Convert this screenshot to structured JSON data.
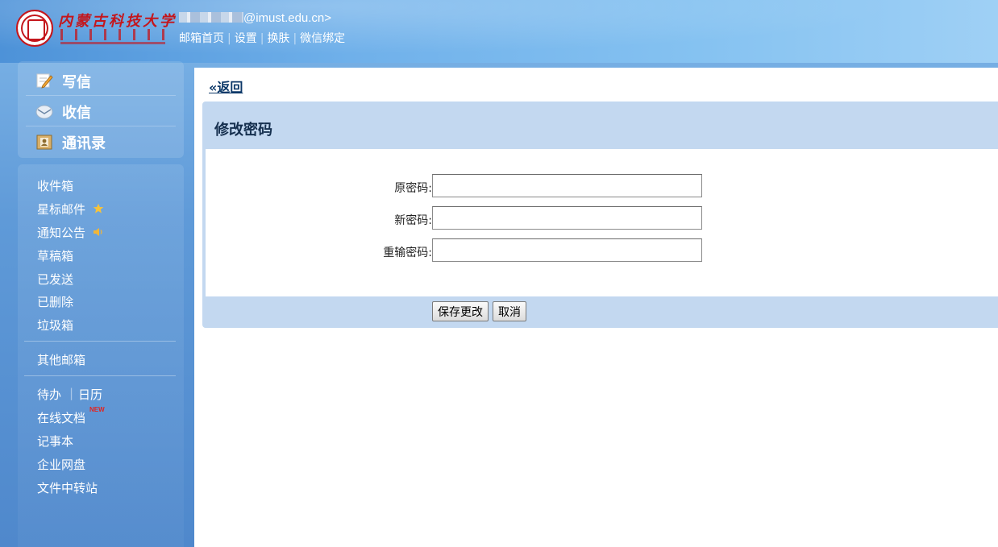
{
  "header": {
    "logo_text": "内蒙古科技大学",
    "user_email_suffix": "@imust.edu.cn>",
    "nav": [
      {
        "label": "邮箱首页"
      },
      {
        "label": "设置"
      },
      {
        "label": "换肤"
      },
      {
        "label": "微信绑定"
      }
    ]
  },
  "sidebar": {
    "primary": [
      {
        "label": "写信",
        "icon": "pencil-icon"
      },
      {
        "label": "收信",
        "icon": "inbox-envelope-icon"
      },
      {
        "label": "通讯录",
        "icon": "address-book-icon"
      }
    ],
    "folders": [
      {
        "label": "收件箱"
      },
      {
        "label": "星标邮件",
        "icon": "star-icon"
      },
      {
        "label": "通知公告",
        "icon": "speaker-icon"
      },
      {
        "label": "草稿箱"
      },
      {
        "label": "已发送"
      },
      {
        "label": "已删除"
      },
      {
        "label": "垃圾箱"
      }
    ],
    "other_mailbox": "其他邮箱",
    "tools": {
      "todo": "待办",
      "calendar": "日历",
      "online_docs": "在线文档",
      "new_badge": "NEW",
      "notepad": "记事本",
      "netdisk": "企业网盘",
      "transfer": "文件中转站"
    }
  },
  "content": {
    "back_link": "«返回",
    "form_title": "修改密码",
    "fields": [
      {
        "label": "原密码:",
        "value": ""
      },
      {
        "label": "新密码:",
        "value": ""
      },
      {
        "label": "重输密码:",
        "value": ""
      }
    ],
    "save_button": "保存更改",
    "cancel_button": "取消"
  },
  "colors": {
    "brand_red": "#c4161c",
    "sidebar_blue": "#5f9ad8",
    "form_panel": "#c3d8f0",
    "link_dark": "#0c3868"
  }
}
